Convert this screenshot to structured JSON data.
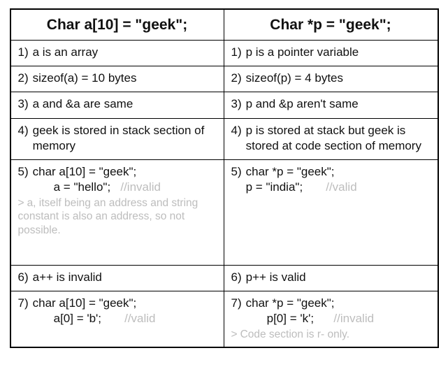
{
  "headers": {
    "left": "Char a[10] = \"geek\";",
    "right": "Char *p = \"geek\";"
  },
  "rows": [
    {
      "left": {
        "num": "1)",
        "text": "a is an array"
      },
      "right": {
        "num": "1)",
        "text": "p is a pointer variable"
      }
    },
    {
      "left": {
        "num": "2)",
        "text": "sizeof(a) = 10 bytes"
      },
      "right": {
        "num": "2)",
        "text": "sizeof(p) = 4 bytes"
      }
    },
    {
      "left": {
        "num": "3)",
        "text": "a and &a are same"
      },
      "right": {
        "num": "3)",
        "text": "p and &p aren't same"
      }
    },
    {
      "left": {
        "num": "4)",
        "text": "geek is stored in stack section of memory"
      },
      "right": {
        "num": "4)",
        "text": "p is stored at stack but geek is stored at code section of memory"
      }
    },
    {
      "left": {
        "num": "5)",
        "code1": "char a[10] = \"geek\";",
        "code2": "a = \"hello\";",
        "comment": "//invalid",
        "note_gt": ">",
        "note": "a, itself being an address and string constant is also an address, so not possible."
      },
      "right": {
        "num": "5)",
        "code1": "char *p = \"geek\";",
        "code2": "p = \"india\";",
        "comment": "//valid"
      }
    },
    {
      "left": {
        "num": "6)",
        "text": "a++ is invalid"
      },
      "right": {
        "num": "6)",
        "text": "p++ is valid"
      }
    },
    {
      "left": {
        "num": "7)",
        "code1": "char a[10] = \"geek\";",
        "code2": "a[0] = 'b';",
        "comment": "//valid"
      },
      "right": {
        "num": "7)",
        "code1": "char *p = \"geek\";",
        "code2": "p[0] = 'k';",
        "comment": "//invalid",
        "note_gt": ">",
        "note": "Code section is r- only."
      }
    }
  ]
}
